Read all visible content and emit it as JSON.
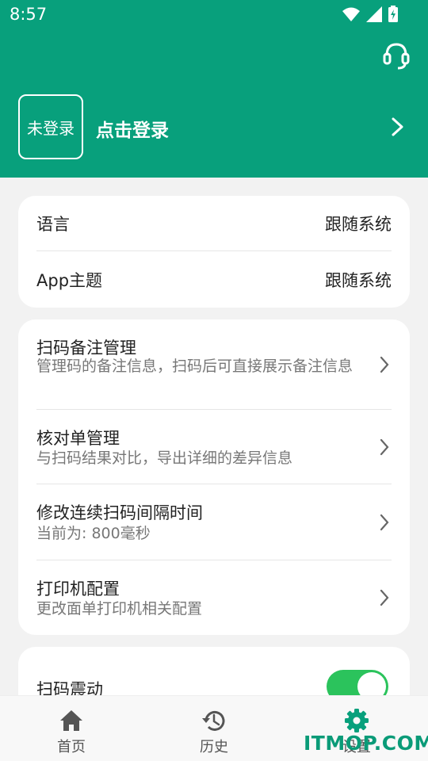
{
  "status_bar": {
    "time": "8:57"
  },
  "header": {
    "avatar_text": "未登录",
    "login_text": "点击登录"
  },
  "card1": {
    "rows": [
      {
        "title": "语言",
        "value": "跟随系统"
      },
      {
        "title": "App主题",
        "value": "跟随系统"
      }
    ]
  },
  "card2": {
    "rows": [
      {
        "title": "扫码备注管理",
        "subtitle": "管理码的备注信息，扫码后可直接展示备注信息"
      },
      {
        "title": "核对单管理",
        "subtitle": "与扫码结果对比，导出详细的差异信息"
      },
      {
        "title": "修改连续扫码间隔时间",
        "subtitle": "当前为: 800毫秒"
      },
      {
        "title": "打印机配置",
        "subtitle": "更改面单打印机相关配置"
      }
    ]
  },
  "card3": {
    "row": {
      "title": "扫码震动"
    }
  },
  "bottom_nav": {
    "items": [
      {
        "label": "首页",
        "icon": "home-icon"
      },
      {
        "label": "历史",
        "icon": "history-icon"
      },
      {
        "label": "设置",
        "icon": "gear-icon"
      }
    ]
  },
  "watermark": "ITMOP.COM",
  "colors": {
    "primary": "#08a07c",
    "toggle_on": "#2bc35c",
    "background": "#f2f2f2"
  }
}
